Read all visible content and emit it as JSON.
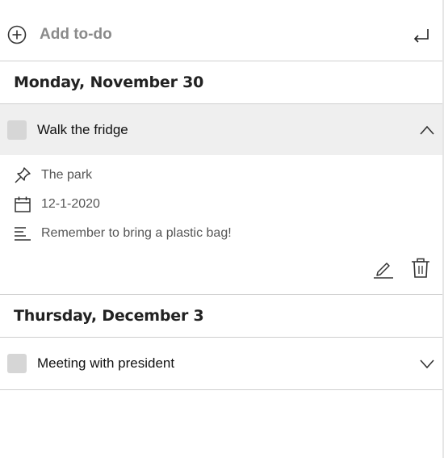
{
  "add_todo": {
    "placeholder": "Add to-do",
    "add_icon": "plus-circle-icon",
    "submit_icon": "enter-return-icon"
  },
  "groups": [
    {
      "date_label": "Monday, November 30",
      "todos": [
        {
          "title": "Walk the fridge",
          "done": false,
          "expanded": true,
          "chevron_icon": "chevron-up-icon",
          "details": {
            "location": "The park",
            "location_icon": "pin-icon",
            "due_date": "12-1-2020",
            "due_date_icon": "calendar-icon",
            "notes": "Remember to bring a plastic bag!",
            "notes_icon": "notes-icon"
          },
          "actions": {
            "edit_icon": "edit-pencil-icon",
            "delete_icon": "trash-icon"
          }
        }
      ]
    },
    {
      "date_label": "Thursday, December 3",
      "todos": [
        {
          "title": "Meeting with president",
          "done": false,
          "expanded": false,
          "chevron_icon": "chevron-down-icon"
        }
      ]
    }
  ],
  "colors": {
    "expanded_row_bg": "#efefef",
    "checkbox_fill": "#d6d6d6",
    "divider": "#cfcfcf",
    "muted_text": "#8a8a8a"
  }
}
